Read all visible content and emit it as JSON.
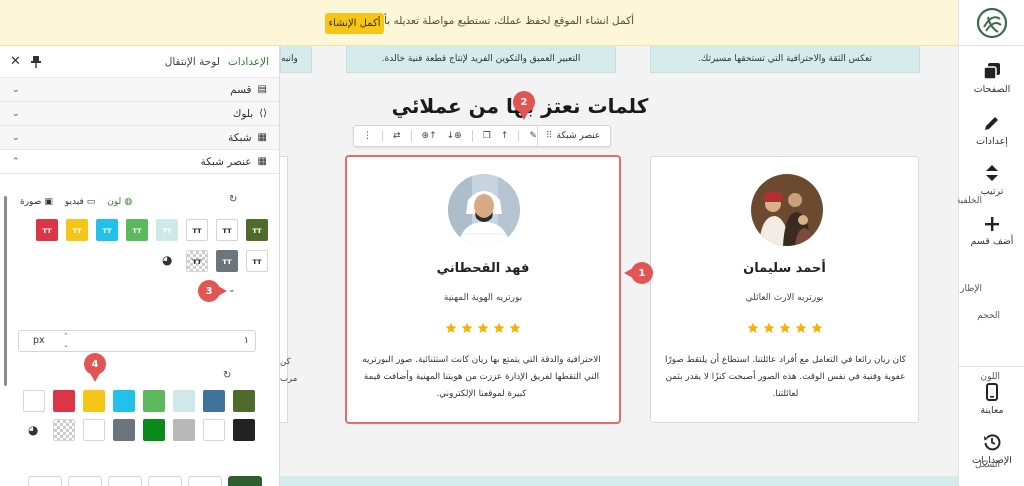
{
  "banner": {
    "message": "أكمل انشاء الموقع لحفظ عملك، تستطيع مواصلة تعديله بأي وقت",
    "complete_button": "أكمل الإنشاء"
  },
  "rail": {
    "items": [
      {
        "label": "الصفحات",
        "icon": "pages-icon"
      },
      {
        "label": "إعدادات",
        "icon": "pencil-icon"
      },
      {
        "label": "ترتيب",
        "icon": "sort-icon"
      },
      {
        "label": "أضف قسم",
        "icon": "plus-icon"
      },
      {
        "label": "معاينة",
        "icon": "mobile-icon"
      },
      {
        "label": "الإصدارات",
        "icon": "history-icon"
      }
    ]
  },
  "panel": {
    "tabs": {
      "settings": "الإعدادات",
      "navigation": "لوحة الإنتقال"
    },
    "sections": {
      "section": "قسم",
      "block": "بلوك",
      "grid": "شبكة",
      "grid_element": "عنصر شبكة"
    },
    "background": {
      "label": "الخلفية",
      "options": {
        "color": "لون",
        "video": "فيديو",
        "image": "صورة"
      }
    },
    "frame": {
      "label": "الإطار",
      "size_label": "الحجم",
      "size_value": "١",
      "size_unit": "px",
      "color_label": "اللون",
      "shape_label": "الشكل"
    },
    "swatch_glyph": "T T"
  },
  "colors": {
    "brand_green": "#4f6b2a",
    "accent_red": "#e25555",
    "banner_bg": "#fdf6d8",
    "cta_yellow": "#f5c518",
    "star": "#f5b301",
    "teal_card": "#d6ecec"
  },
  "canvas": {
    "top_cards": [
      "تعكس الثقة والاحترافية التي تستحقها مسيرتك.",
      "التعبير العميق والتكوين الفريد لإنتاج قطعة فنية خالدة.",
      "وانبه"
    ],
    "section_title": "كلمات نعتز بها من عملائي",
    "toolbar": {
      "element_name": "عنصر شبكة"
    },
    "cards": [
      {
        "name": "أحمد سليمان",
        "role": "بورتريه الارث العائلي",
        "text": "كان ريان رائعا في التعامل مع أفراد عائلتنا. استطاع أن يلتقط صورًا عفوية وفنية في نفس الوقت. هذه الصور أصبحت كنزًا لا يقدر بثمن لعائلتنا.",
        "rating": 5
      },
      {
        "name": "فهد القحطاني",
        "role": "بورتريه الهوية المهنية",
        "text": "الاحترافية والدقة التي يتمتع بها ريان كانت استثنائية. صور البورتريه التي التقطها لفريق الإدارة عززت من هويتنا المهنية وأضافت قيمة كبيرة لموقعنا الإلكتروني.",
        "rating": 5
      }
    ],
    "side_snippets": [
      "كن",
      "مرب"
    ]
  },
  "annotations": [
    "1",
    "2",
    "3",
    "4"
  ]
}
